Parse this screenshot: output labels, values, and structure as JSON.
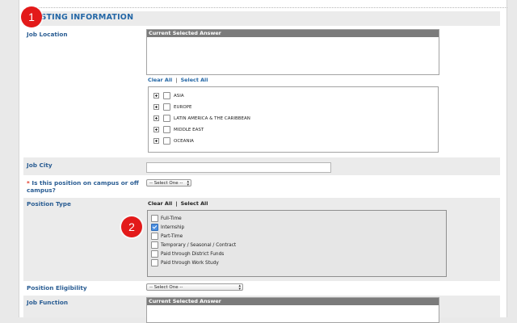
{
  "markers": [
    "1",
    "2"
  ],
  "section": {
    "title": "POSTING INFORMATION"
  },
  "job_location": {
    "label": "Job Location",
    "csa_header": "Current Selected Answer",
    "clear_all": "Clear All",
    "sep": "|",
    "select_all": "Select All",
    "regions": [
      "ASIA",
      "EUROPE",
      "LATIN AMERICA & THE CARIBBEAN",
      "MIDDLE EAST",
      "OCEANIA"
    ]
  },
  "job_city": {
    "label": "Job City",
    "value": ""
  },
  "campus": {
    "required_mark": "*",
    "label": "Is this position on campus or off campus?",
    "select_value": "-- Select One --"
  },
  "position_type": {
    "label": "Position Type",
    "clear_all": "Clear All",
    "sep": "|",
    "select_all": "Select All",
    "options": [
      {
        "label": "Full-Time",
        "checked": false
      },
      {
        "label": "Internship",
        "checked": true
      },
      {
        "label": "Part-Time",
        "checked": false
      },
      {
        "label": "Temporary / Seasonal / Contract",
        "checked": false
      },
      {
        "label": "Paid through District Funds",
        "checked": false
      },
      {
        "label": "Paid through Work Study",
        "checked": false
      }
    ]
  },
  "eligibility": {
    "label": "Position Eligibility",
    "select_value": "-- Select One --"
  },
  "job_function": {
    "label": "Job Function",
    "csa_header": "Current Selected Answer"
  },
  "colors": {
    "accent": "#2467a6",
    "marker": "#e31a1a",
    "row_gray": "#ebebeb",
    "csa_header": "#7b7b7b"
  }
}
